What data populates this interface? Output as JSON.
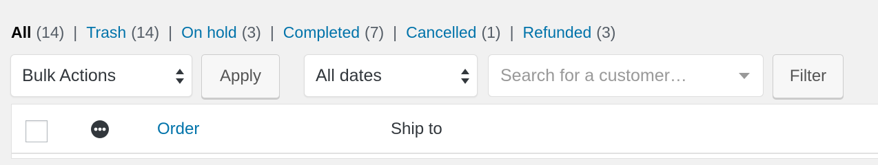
{
  "status_filters": [
    {
      "label": "All",
      "count": "(14)",
      "current": true
    },
    {
      "label": "Trash",
      "count": "(14)",
      "current": false
    },
    {
      "label": "On hold",
      "count": "(3)",
      "current": false
    },
    {
      "label": "Completed",
      "count": "(7)",
      "current": false
    },
    {
      "label": "Cancelled",
      "count": "(1)",
      "current": false
    },
    {
      "label": "Refunded",
      "count": "(3)",
      "current": false
    }
  ],
  "separator": "|",
  "toolbar": {
    "bulk_actions": "Bulk Actions",
    "apply_label": "Apply",
    "dates_filter": "All dates",
    "customer_search_placeholder": "Search for a customer…",
    "filter_label": "Filter"
  },
  "table": {
    "columns": {
      "order": "Order",
      "ship_to": "Ship to"
    }
  },
  "icons": {
    "actions_column": "more-dots-icon",
    "select_arrows": "select-arrows-icon",
    "dropdown_caret": "chevron-down-icon"
  },
  "colors": {
    "link": "#0073aa",
    "background": "#f1f1f1",
    "text": "#32373c"
  }
}
